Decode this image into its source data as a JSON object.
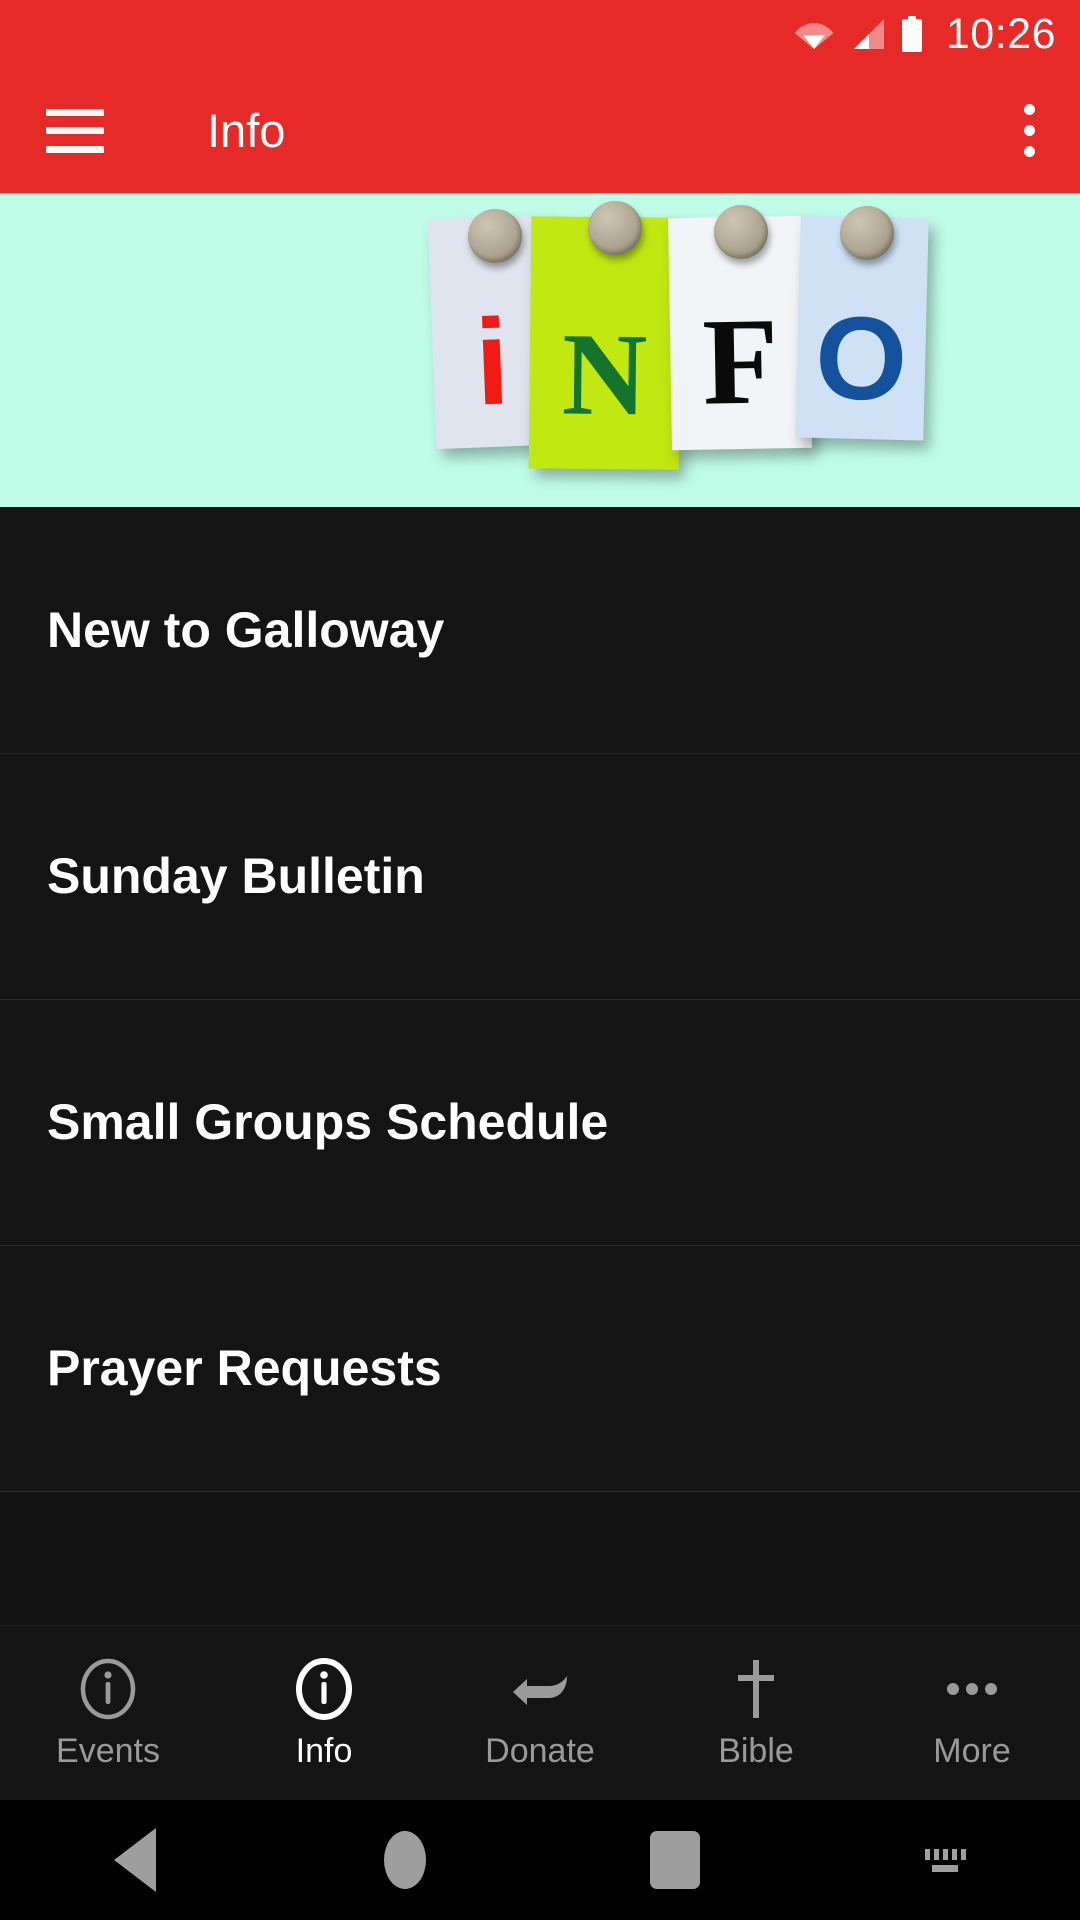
{
  "status_bar": {
    "time": "10:26",
    "icons": [
      "wifi-icon",
      "cellular-signal-icon",
      "battery-icon"
    ]
  },
  "app_bar": {
    "menu_icon": "hamburger-menu-icon",
    "title": "Info",
    "overflow_icon": "overflow-menu-icon",
    "background_color": "#E52A28"
  },
  "hero": {
    "alt": "Sticky notes pinned with round magnets spelling INFO",
    "background_color": "#C0FDE9",
    "notes": [
      {
        "letter": "i",
        "paper_color": "#dfe4ee",
        "letter_color": "#F21A14"
      },
      {
        "letter": "N",
        "paper_color": "#C2E812",
        "letter_color": "#14742D"
      },
      {
        "letter": "F",
        "paper_color": "#f2f4f7",
        "letter_color": "#0a0a0a"
      },
      {
        "letter": "O",
        "paper_color": "#cfe2f5",
        "letter_color": "#15529E"
      }
    ]
  },
  "list": {
    "items": [
      {
        "label": "New to Galloway"
      },
      {
        "label": "Sunday Bulletin"
      },
      {
        "label": "Small Groups Schedule"
      },
      {
        "label": "Prayer Requests"
      }
    ]
  },
  "tab_bar": {
    "tabs": [
      {
        "label": "Events",
        "icon": "info-circle-icon",
        "active": false
      },
      {
        "label": "Info",
        "icon": "info-circle-icon",
        "active": true
      },
      {
        "label": "Donate",
        "icon": "giving-hand-icon",
        "active": false
      },
      {
        "label": "Bible",
        "icon": "cross-icon",
        "active": false
      },
      {
        "label": "More",
        "icon": "ellipsis-icon",
        "active": false
      }
    ],
    "active_color": "#ffffff",
    "inactive_color": "#9a9a9a"
  },
  "system_nav": {
    "buttons": [
      {
        "name": "back-button"
      },
      {
        "name": "home-button"
      },
      {
        "name": "recents-button"
      },
      {
        "name": "keyboard-indicator"
      }
    ]
  }
}
